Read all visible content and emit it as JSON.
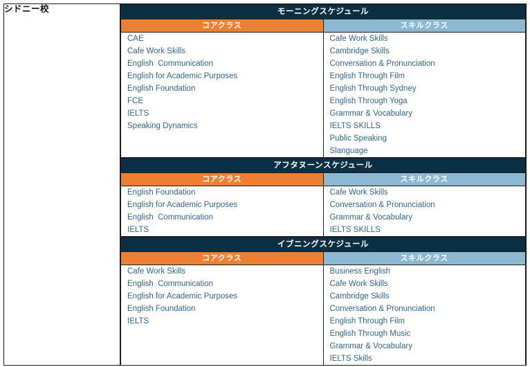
{
  "campus": {
    "name": "シドニー校"
  },
  "colors": {
    "section_header_bg": "#0a3043",
    "core_header_bg": "#ed8033",
    "skill_header_bg": "#8cb8d2",
    "list_text": "#31658c",
    "border": "#1b1b1b",
    "page_bg": "#ffffff"
  },
  "column_headers": {
    "core": "コアクラス",
    "skill": "スキルクラス"
  },
  "schedules": [
    {
      "title": "モーニングスケジュール",
      "core_label": "コアクラス",
      "skill_label": "スキルクラス",
      "core_classes": [
        "CAE",
        "Cafe Work Skills",
        "English  Communication",
        "English for Academic Purposes",
        "English Foundation",
        "FCE",
        "IELTS",
        "Speaking Dynamics"
      ],
      "skill_classes": [
        "Cafe Work Skills",
        "Cambridge Skills",
        "Conversation & Pronunciation",
        "English Through Film",
        "English Through Sydney",
        "English Through Yoga",
        "Grammar & Vocabulary",
        "IELTS SKILLS",
        "Public Speaking",
        "Slanguage"
      ]
    },
    {
      "title": "アフタヌーンスケジュール",
      "core_label": "コアクラス",
      "skill_label": "スキルクラス",
      "core_classes": [
        "English Foundation",
        "English for Academic Purposes",
        "English  Communication",
        "IELTS"
      ],
      "skill_classes": [
        "Cafe Work Skills",
        "Conversation & Pronunciation",
        "Grammar & Vocabulary",
        "IELTS SKILLS"
      ]
    },
    {
      "title": "イブニングスケジュール",
      "core_label": "コアクラス",
      "skill_label": "スキルクラス",
      "core_classes": [
        "Cafe Work Skills",
        "English  Communication",
        "English for Academic Purposes",
        "English Foundation",
        "IELTS"
      ],
      "skill_classes": [
        "Business English",
        "Cafe Work Skills",
        "Cambridge Skills",
        "Conversation & Pronunciation",
        "English Through Film",
        "English Through Music",
        "Grammar & Vocabulary",
        "IELTS Skills"
      ]
    }
  ]
}
